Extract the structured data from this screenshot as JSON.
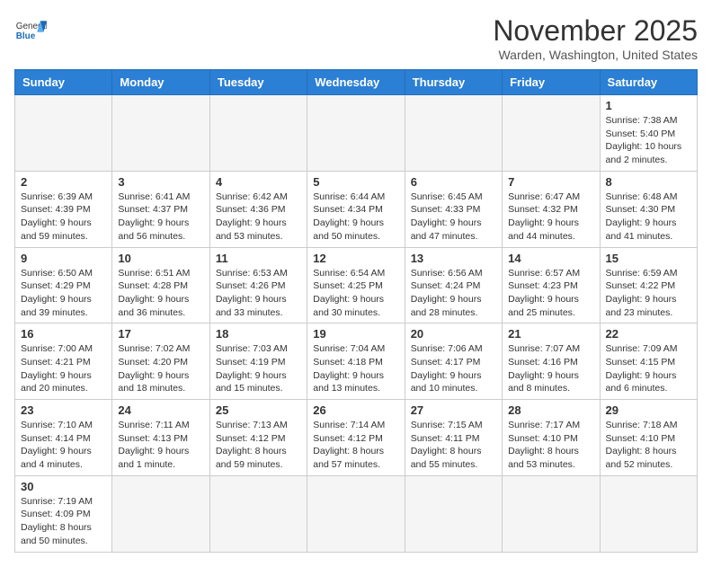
{
  "header": {
    "logo_general": "General",
    "logo_blue": "Blue",
    "month_title": "November 2025",
    "subtitle": "Warden, Washington, United States"
  },
  "days_of_week": [
    "Sunday",
    "Monday",
    "Tuesday",
    "Wednesday",
    "Thursday",
    "Friday",
    "Saturday"
  ],
  "weeks": [
    [
      {
        "day": "",
        "info": ""
      },
      {
        "day": "",
        "info": ""
      },
      {
        "day": "",
        "info": ""
      },
      {
        "day": "",
        "info": ""
      },
      {
        "day": "",
        "info": ""
      },
      {
        "day": "",
        "info": ""
      },
      {
        "day": "1",
        "info": "Sunrise: 7:38 AM\nSunset: 5:40 PM\nDaylight: 10 hours\nand 2 minutes."
      }
    ],
    [
      {
        "day": "2",
        "info": "Sunrise: 6:39 AM\nSunset: 4:39 PM\nDaylight: 9 hours\nand 59 minutes."
      },
      {
        "day": "3",
        "info": "Sunrise: 6:41 AM\nSunset: 4:37 PM\nDaylight: 9 hours\nand 56 minutes."
      },
      {
        "day": "4",
        "info": "Sunrise: 6:42 AM\nSunset: 4:36 PM\nDaylight: 9 hours\nand 53 minutes."
      },
      {
        "day": "5",
        "info": "Sunrise: 6:44 AM\nSunset: 4:34 PM\nDaylight: 9 hours\nand 50 minutes."
      },
      {
        "day": "6",
        "info": "Sunrise: 6:45 AM\nSunset: 4:33 PM\nDaylight: 9 hours\nand 47 minutes."
      },
      {
        "day": "7",
        "info": "Sunrise: 6:47 AM\nSunset: 4:32 PM\nDaylight: 9 hours\nand 44 minutes."
      },
      {
        "day": "8",
        "info": "Sunrise: 6:48 AM\nSunset: 4:30 PM\nDaylight: 9 hours\nand 41 minutes."
      }
    ],
    [
      {
        "day": "9",
        "info": "Sunrise: 6:50 AM\nSunset: 4:29 PM\nDaylight: 9 hours\nand 39 minutes."
      },
      {
        "day": "10",
        "info": "Sunrise: 6:51 AM\nSunset: 4:28 PM\nDaylight: 9 hours\nand 36 minutes."
      },
      {
        "day": "11",
        "info": "Sunrise: 6:53 AM\nSunset: 4:26 PM\nDaylight: 9 hours\nand 33 minutes."
      },
      {
        "day": "12",
        "info": "Sunrise: 6:54 AM\nSunset: 4:25 PM\nDaylight: 9 hours\nand 30 minutes."
      },
      {
        "day": "13",
        "info": "Sunrise: 6:56 AM\nSunset: 4:24 PM\nDaylight: 9 hours\nand 28 minutes."
      },
      {
        "day": "14",
        "info": "Sunrise: 6:57 AM\nSunset: 4:23 PM\nDaylight: 9 hours\nand 25 minutes."
      },
      {
        "day": "15",
        "info": "Sunrise: 6:59 AM\nSunset: 4:22 PM\nDaylight: 9 hours\nand 23 minutes."
      }
    ],
    [
      {
        "day": "16",
        "info": "Sunrise: 7:00 AM\nSunset: 4:21 PM\nDaylight: 9 hours\nand 20 minutes."
      },
      {
        "day": "17",
        "info": "Sunrise: 7:02 AM\nSunset: 4:20 PM\nDaylight: 9 hours\nand 18 minutes."
      },
      {
        "day": "18",
        "info": "Sunrise: 7:03 AM\nSunset: 4:19 PM\nDaylight: 9 hours\nand 15 minutes."
      },
      {
        "day": "19",
        "info": "Sunrise: 7:04 AM\nSunset: 4:18 PM\nDaylight: 9 hours\nand 13 minutes."
      },
      {
        "day": "20",
        "info": "Sunrise: 7:06 AM\nSunset: 4:17 PM\nDaylight: 9 hours\nand 10 minutes."
      },
      {
        "day": "21",
        "info": "Sunrise: 7:07 AM\nSunset: 4:16 PM\nDaylight: 9 hours\nand 8 minutes."
      },
      {
        "day": "22",
        "info": "Sunrise: 7:09 AM\nSunset: 4:15 PM\nDaylight: 9 hours\nand 6 minutes."
      }
    ],
    [
      {
        "day": "23",
        "info": "Sunrise: 7:10 AM\nSunset: 4:14 PM\nDaylight: 9 hours\nand 4 minutes."
      },
      {
        "day": "24",
        "info": "Sunrise: 7:11 AM\nSunset: 4:13 PM\nDaylight: 9 hours\nand 1 minute."
      },
      {
        "day": "25",
        "info": "Sunrise: 7:13 AM\nSunset: 4:12 PM\nDaylight: 8 hours\nand 59 minutes."
      },
      {
        "day": "26",
        "info": "Sunrise: 7:14 AM\nSunset: 4:12 PM\nDaylight: 8 hours\nand 57 minutes."
      },
      {
        "day": "27",
        "info": "Sunrise: 7:15 AM\nSunset: 4:11 PM\nDaylight: 8 hours\nand 55 minutes."
      },
      {
        "day": "28",
        "info": "Sunrise: 7:17 AM\nSunset: 4:10 PM\nDaylight: 8 hours\nand 53 minutes."
      },
      {
        "day": "29",
        "info": "Sunrise: 7:18 AM\nSunset: 4:10 PM\nDaylight: 8 hours\nand 52 minutes."
      }
    ],
    [
      {
        "day": "30",
        "info": "Sunrise: 7:19 AM\nSunset: 4:09 PM\nDaylight: 8 hours\nand 50 minutes."
      },
      {
        "day": "",
        "info": ""
      },
      {
        "day": "",
        "info": ""
      },
      {
        "day": "",
        "info": ""
      },
      {
        "day": "",
        "info": ""
      },
      {
        "day": "",
        "info": ""
      },
      {
        "day": "",
        "info": ""
      }
    ]
  ]
}
